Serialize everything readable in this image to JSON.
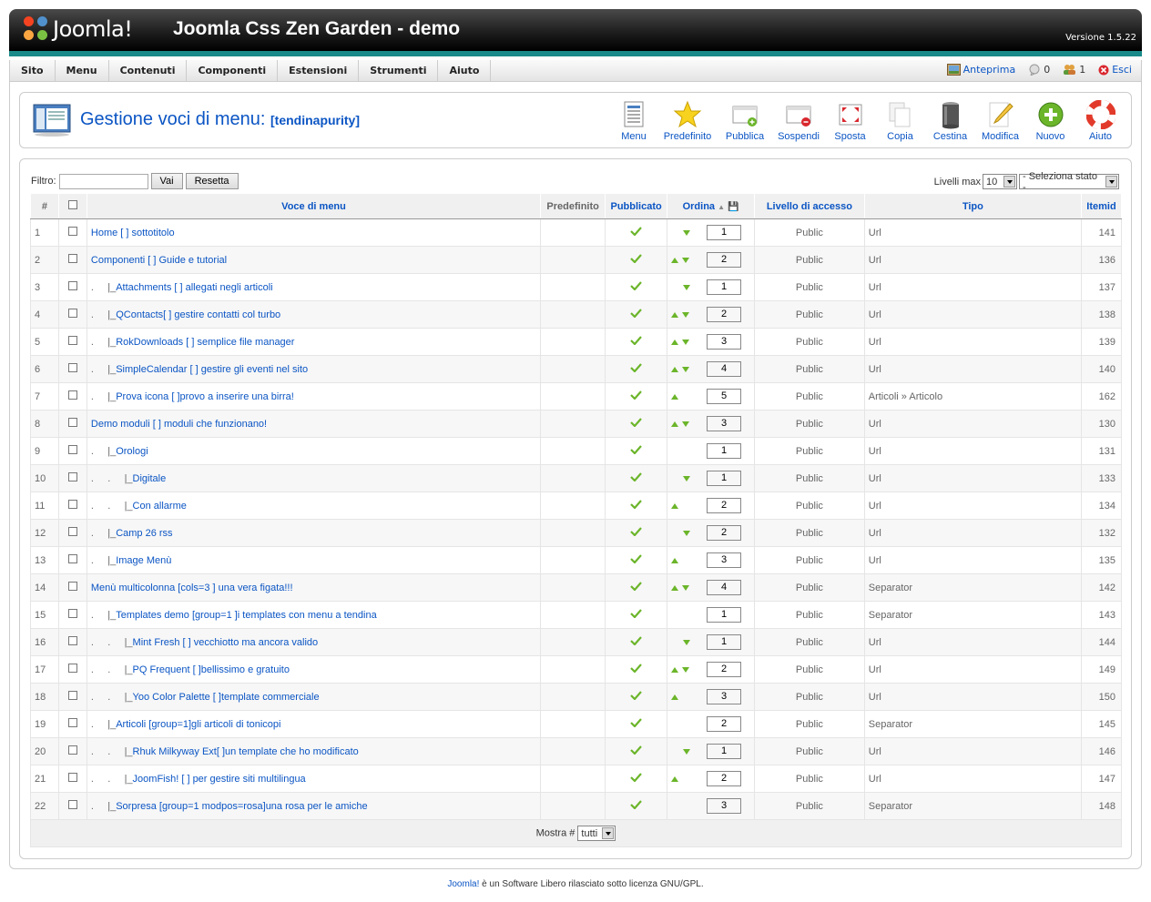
{
  "header": {
    "logo_text": "Joomla!",
    "site_title": "Joomla Css Zen Garden - demo",
    "version": "Versione 1.5.22"
  },
  "menubar": {
    "items": [
      "Sito",
      "Menu",
      "Contenuti",
      "Componenti",
      "Estensioni",
      "Strumenti",
      "Aiuto"
    ],
    "preview": "Anteprima",
    "messages": "0",
    "users": "1",
    "logout": "Esci"
  },
  "toolbar": {
    "title": "Gestione voci di menu:",
    "subtitle": "[tendinapurity]",
    "buttons": [
      "Menu",
      "Predefinito",
      "Pubblica",
      "Sospendi",
      "Sposta",
      "Copia",
      "Cestina",
      "Modifica",
      "Nuovo",
      "Aiuto"
    ]
  },
  "filter": {
    "label": "Filtro:",
    "value": "",
    "go_label": "Vai",
    "reset_label": "Resetta",
    "levels_label": "Livelli max",
    "levels_value": "10",
    "state_value": "- Seleziona stato -"
  },
  "table": {
    "headers": {
      "num": "#",
      "name": "Voce di menu",
      "default": "Predefinito",
      "published": "Pubblicato",
      "order": "Ordina",
      "access": "Livello di accesso",
      "type": "Tipo",
      "itemid": "Itemid"
    },
    "rows": [
      {
        "n": "1",
        "indent": "",
        "name": "Home [ ] sottotitolo",
        "up": false,
        "down": true,
        "order": "1",
        "access": "Public",
        "type": "Url",
        "itemid": "141"
      },
      {
        "n": "2",
        "indent": "",
        "name": "Componenti [ ] Guide e tutorial",
        "up": true,
        "down": true,
        "order": "2",
        "access": "Public",
        "type": "Url",
        "itemid": "136"
      },
      {
        "n": "3",
        "indent": ".     |_",
        "name": "Attachments [ ] allegati negli articoli",
        "up": false,
        "down": true,
        "order": "1",
        "access": "Public",
        "type": "Url",
        "itemid": "137"
      },
      {
        "n": "4",
        "indent": ".     |_",
        "name": "QContacts[ ] gestire contatti col turbo",
        "up": true,
        "down": true,
        "order": "2",
        "access": "Public",
        "type": "Url",
        "itemid": "138"
      },
      {
        "n": "5",
        "indent": ".     |_",
        "name": "RokDownloads [ ] semplice file manager",
        "up": true,
        "down": true,
        "order": "3",
        "access": "Public",
        "type": "Url",
        "itemid": "139"
      },
      {
        "n": "6",
        "indent": ".     |_",
        "name": "SimpleCalendar [ ] gestire gli eventi nel sito",
        "up": true,
        "down": true,
        "order": "4",
        "access": "Public",
        "type": "Url",
        "itemid": "140"
      },
      {
        "n": "7",
        "indent": ".     |_",
        "name": "Prova icona [ ]provo a inserire una birra!",
        "up": true,
        "down": false,
        "order": "5",
        "access": "Public",
        "type": "Articoli » Articolo",
        "itemid": "162"
      },
      {
        "n": "8",
        "indent": "",
        "name": "Demo moduli [ ] moduli che funzionano!",
        "up": true,
        "down": true,
        "order": "3",
        "access": "Public",
        "type": "Url",
        "itemid": "130"
      },
      {
        "n": "9",
        "indent": ".     |_",
        "name": "Orologi",
        "up": false,
        "down": false,
        "order": "1",
        "access": "Public",
        "type": "Url",
        "itemid": "131"
      },
      {
        "n": "10",
        "indent": ".     .     |_",
        "name": "Digitale",
        "up": false,
        "down": true,
        "order": "1",
        "access": "Public",
        "type": "Url",
        "itemid": "133"
      },
      {
        "n": "11",
        "indent": ".     .     |_",
        "name": "Con allarme",
        "up": true,
        "down": false,
        "order": "2",
        "access": "Public",
        "type": "Url",
        "itemid": "134"
      },
      {
        "n": "12",
        "indent": ".     |_",
        "name": "Camp 26 rss",
        "up": false,
        "down": true,
        "order": "2",
        "access": "Public",
        "type": "Url",
        "itemid": "132"
      },
      {
        "n": "13",
        "indent": ".     |_",
        "name": "Image Menù",
        "up": true,
        "down": false,
        "order": "3",
        "access": "Public",
        "type": "Url",
        "itemid": "135"
      },
      {
        "n": "14",
        "indent": "",
        "name": "Menù multicolonna [cols=3 ] una vera figata!!!",
        "up": true,
        "down": true,
        "order": "4",
        "access": "Public",
        "type": "Separator",
        "itemid": "142"
      },
      {
        "n": "15",
        "indent": ".     |_",
        "name": "Templates demo [group=1 ]i templates con menu a tendina",
        "up": false,
        "down": false,
        "order": "1",
        "access": "Public",
        "type": "Separator",
        "itemid": "143"
      },
      {
        "n": "16",
        "indent": ".     .     |_",
        "name": "Mint Fresh [ ] vecchiotto ma ancora valido",
        "up": false,
        "down": true,
        "order": "1",
        "access": "Public",
        "type": "Url",
        "itemid": "144"
      },
      {
        "n": "17",
        "indent": ".     .     |_",
        "name": "PQ Frequent [ ]bellissimo e gratuito",
        "up": true,
        "down": true,
        "order": "2",
        "access": "Public",
        "type": "Url",
        "itemid": "149"
      },
      {
        "n": "18",
        "indent": ".     .     |_",
        "name": "Yoo Color Palette [ ]template commerciale",
        "up": true,
        "down": false,
        "order": "3",
        "access": "Public",
        "type": "Url",
        "itemid": "150"
      },
      {
        "n": "19",
        "indent": ".     |_",
        "name": "Articoli [group=1]gli articoli di tonicopi",
        "up": false,
        "down": false,
        "order": "2",
        "access": "Public",
        "type": "Separator",
        "itemid": "145"
      },
      {
        "n": "20",
        "indent": ".     .     |_",
        "name": "Rhuk Milkyway Ext[ ]un template che ho modificato",
        "up": false,
        "down": true,
        "order": "1",
        "access": "Public",
        "type": "Url",
        "itemid": "146"
      },
      {
        "n": "21",
        "indent": ".     .     |_",
        "name": "JoomFish! [ ] per gestire siti multilingua",
        "up": true,
        "down": false,
        "order": "2",
        "access": "Public",
        "type": "Url",
        "itemid": "147"
      },
      {
        "n": "22",
        "indent": ".     |_",
        "name": "Sorpresa [group=1 modpos=rosa]una rosa per le amiche",
        "up": false,
        "down": false,
        "order": "3",
        "access": "Public",
        "type": "Separator",
        "itemid": "148"
      }
    ],
    "footer_label": "Mostra #",
    "footer_value": "tutti"
  },
  "footer": {
    "link": "Joomla!",
    "text": " è un Software Libero rilasciato sotto licenza GNU/GPL."
  },
  "colors": {
    "link": "#0b55c4",
    "accent": "#1a8a8a",
    "published": "#6bb52a",
    "access": "#008800"
  }
}
